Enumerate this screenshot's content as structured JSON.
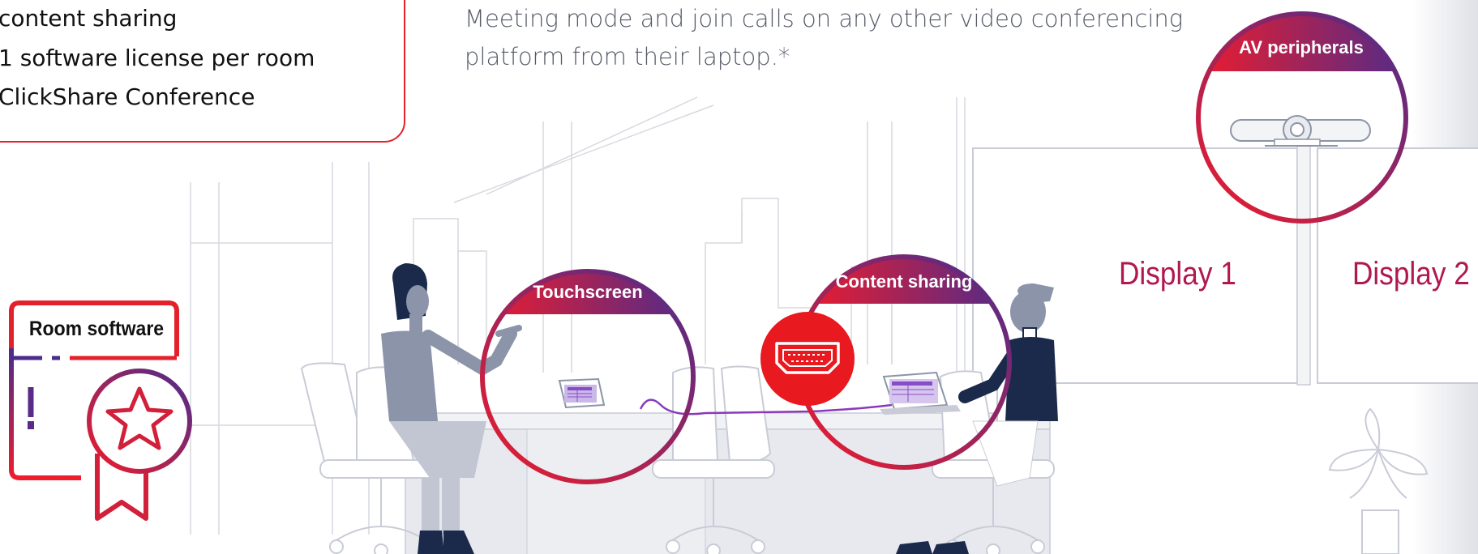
{
  "features": [
    "content sharing",
    "1 software license per room",
    "ClickShare Conference"
  ],
  "description": {
    "line1": "Meeting mode and join calls on any other video conferencing",
    "line2": "platform from their laptop.*"
  },
  "callouts": {
    "touchscreen": "Touchscreen",
    "content_sharing": "Content sharing",
    "av_peripherals": "AV peripherals"
  },
  "displays": {
    "display_1": "Display 1",
    "display_2": "Display 2"
  },
  "room_software": "Room software",
  "colors": {
    "accent_red": "#e4202b",
    "accent_purple": "#4b2c8c",
    "display_text": "#b0194f",
    "navy": "#1b2a4a",
    "line_gray": "#c9ccd6"
  },
  "icons": [
    "hdmi-icon",
    "award-star-icon",
    "plant-icon",
    "camera-bar-icon"
  ]
}
